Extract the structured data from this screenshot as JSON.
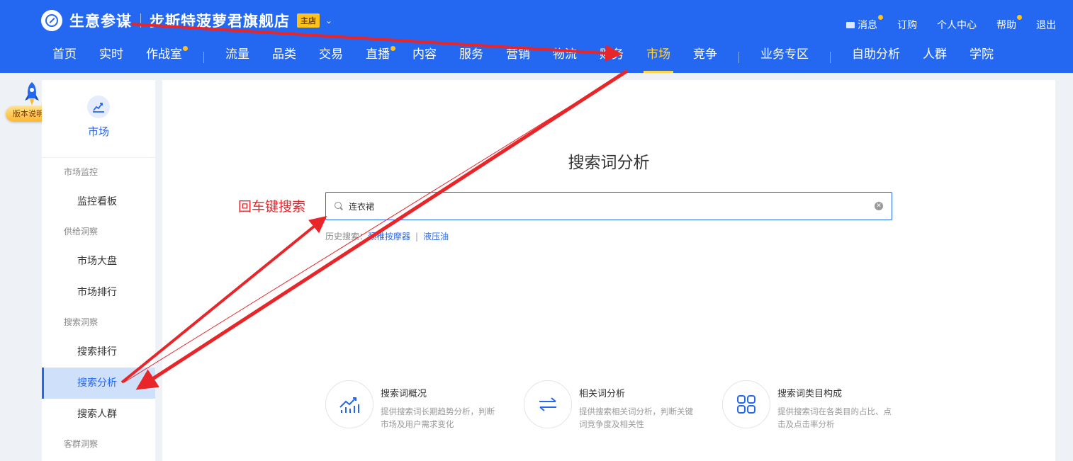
{
  "header": {
    "brand": "生意参谋",
    "shop_name": "步斯特菠萝君旗舰店",
    "shop_badge": "主店",
    "top_links": {
      "messages": "消息",
      "subscribe": "订购",
      "profile": "个人中心",
      "help": "帮助",
      "logout": "退出"
    },
    "nav": {
      "home": "首页",
      "realtime": "实时",
      "warroom": "作战室",
      "traffic": "流量",
      "category": "品类",
      "trade": "交易",
      "live": "直播",
      "content": "内容",
      "service": "服务",
      "marketing": "营销",
      "logistics": "物流",
      "finance": "财务",
      "market": "市场",
      "compete": "竞争",
      "business": "业务专区",
      "selfanalysis": "自助分析",
      "crowd": "人群",
      "academy": "学院"
    }
  },
  "version_badge": "版本说明",
  "sidebar": {
    "title": "市场",
    "groups": {
      "monitor": "市场监控",
      "monitor_board": "监控看板",
      "supply": "供给洞察",
      "market_overview": "市场大盘",
      "market_rank": "市场排行",
      "search": "搜索洞察",
      "search_rank": "搜索排行",
      "search_analysis": "搜索分析",
      "search_crowd": "搜索人群",
      "customer": "客群洞察"
    }
  },
  "main": {
    "title": "搜索词分析",
    "annotation": "回车键搜索",
    "search": {
      "value": "连衣裙"
    },
    "history": {
      "label": "历史搜索：",
      "items": [
        "颈椎按摩器",
        "液压油"
      ],
      "separator": "|"
    },
    "features": [
      {
        "title": "搜索词概况",
        "desc": "提供搜索词长期趋势分析，判断市场及用户需求变化"
      },
      {
        "title": "相关词分析",
        "desc": "提供搜索相关词分析，判断关键词竞争度及相关性"
      },
      {
        "title": "搜索词类目构成",
        "desc": "提供搜索词在各类目的占比、点击及点击率分析"
      }
    ]
  },
  "colors": {
    "primary": "#2468f2",
    "active_nav": "#ffd54a",
    "annotation": "#e8262a",
    "badge": "#ffc21a"
  }
}
